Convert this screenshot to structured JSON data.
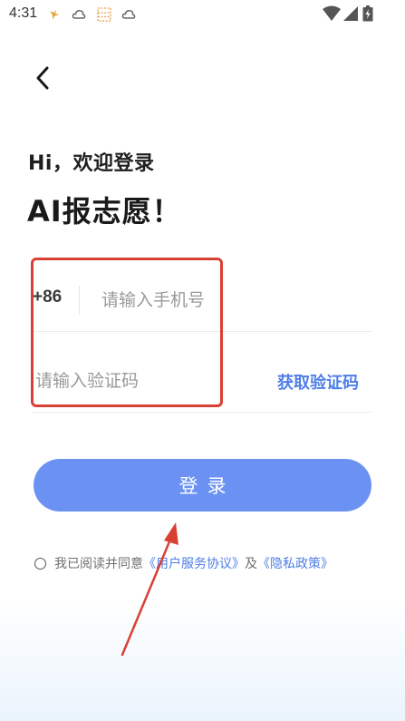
{
  "status_bar": {
    "time": "4:31",
    "left_icons": [
      "bird-icon",
      "cloud-icon",
      "grid-icon",
      "cloud-icon"
    ],
    "right_icons": [
      "wifi-icon",
      "signal-icon",
      "battery-icon"
    ]
  },
  "greeting": "Hi，欢迎登录",
  "headline": "AI报志愿！",
  "form": {
    "country_code": "+86",
    "phone_placeholder": "请输入手机号",
    "code_placeholder": "请输入验证码",
    "get_code_label": "获取验证码"
  },
  "login_label": "登录",
  "agreement": {
    "prefix": "我已阅读并同意",
    "user_agreement": "《用户服务协议》",
    "conjunction": "及",
    "privacy_policy": "《隐私政策》"
  },
  "colors": {
    "accent": "#6b91f2",
    "link": "#4f7ee6",
    "annotation": "#d94034"
  }
}
